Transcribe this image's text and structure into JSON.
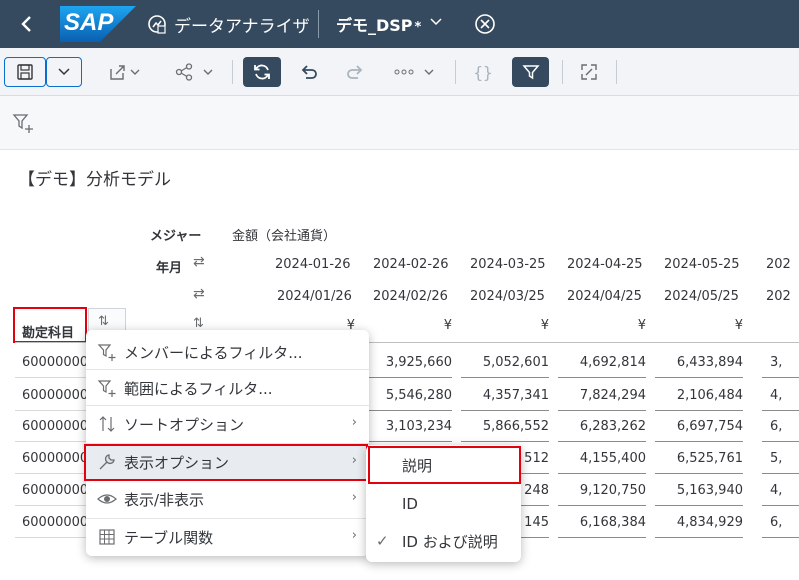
{
  "shell": {
    "logo_text": "SAP",
    "app_title": "データアナライザ",
    "doc_title": "デモ_DSP",
    "doc_modified": "*"
  },
  "model_title": "【デモ】分析モデル",
  "table": {
    "measure_label": "メジャー",
    "measure_value": "金額（会社通貨）",
    "period_label": "年月",
    "account_label": "勘定科目",
    "dates_id": [
      "2024-01-26",
      "2024-02-26",
      "2024-03-25",
      "2024-04-25",
      "2024-05-25",
      "202"
    ],
    "dates_desc": [
      "2024/01/26",
      "2024/02/26",
      "2024/03/25",
      "2024/04/25",
      "2024/05/25",
      "202"
    ],
    "currency": [
      "¥",
      "¥",
      "¥",
      "¥",
      "¥"
    ],
    "rows": [
      {
        "account": "60000000",
        "values": [
          "3,925,660",
          "5,052,601",
          "4,692,814",
          "6,433,894",
          "3,"
        ]
      },
      {
        "account": "60000000",
        "values": [
          "5,546,280",
          "4,357,341",
          "7,824,294",
          "2,106,484",
          "4,"
        ]
      },
      {
        "account": "60000000",
        "values": [
          "3,103,234",
          "5,866,552",
          "6,283,262",
          "6,697,754",
          "6,"
        ]
      },
      {
        "account": "60000000",
        "values": [
          "512",
          "4,155,400",
          "6,525,761",
          "5,"
        ]
      },
      {
        "account": "60000000",
        "values": [
          "248",
          "9,120,750",
          "5,163,940",
          "4,"
        ]
      },
      {
        "account": "60000000",
        "values": [
          "145",
          "6,168,384",
          "4,834,929",
          "6,"
        ]
      }
    ]
  },
  "context_menu": {
    "items": [
      {
        "label": "メンバーによるフィルタ...",
        "icon": "filter-plus-icon",
        "has_sub": false
      },
      {
        "label": "範囲によるフィルタ...",
        "icon": "filter-plus-icon",
        "has_sub": false
      },
      {
        "label": "ソートオプション",
        "icon": "sort-icon",
        "has_sub": true
      },
      {
        "label": "表示オプション",
        "icon": "wrench-icon",
        "has_sub": true
      },
      {
        "label": "表示/非表示",
        "icon": "eye-icon",
        "has_sub": true
      },
      {
        "label": "テーブル関数",
        "icon": "table-icon",
        "has_sub": true
      }
    ]
  },
  "submenu": {
    "items": [
      {
        "label": "説明",
        "checked": false
      },
      {
        "label": "ID",
        "checked": false
      },
      {
        "label": "ID および説明",
        "checked": true
      }
    ]
  },
  "colors": {
    "shell_bg": "#354a5f",
    "accent": "#0a6ed1",
    "highlight_red": "#e3000f"
  }
}
